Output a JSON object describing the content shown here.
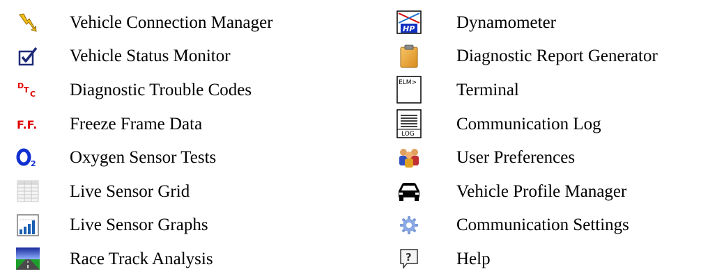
{
  "left_menu": {
    "items": [
      {
        "label": "Vehicle Connection Manager",
        "icon": "lightning-bolt-icon"
      },
      {
        "label": "Vehicle Status Monitor",
        "icon": "checkbox-checked-icon"
      },
      {
        "label": "Diagnostic Trouble Codes",
        "icon": "dtc-icon"
      },
      {
        "label": "Freeze Frame Data",
        "icon": "freeze-frame-icon"
      },
      {
        "label": "Oxygen Sensor Tests",
        "icon": "oxygen-sensor-icon"
      },
      {
        "label": "Live Sensor Grid",
        "icon": "grid-table-icon"
      },
      {
        "label": "Live Sensor Graphs",
        "icon": "bar-graph-icon"
      },
      {
        "label": "Race Track Analysis",
        "icon": "race-track-icon"
      }
    ]
  },
  "right_menu": {
    "items": [
      {
        "label": "Dynamometer",
        "icon": "dynamometer-hp-icon",
        "icon_text": "HP"
      },
      {
        "label": "Diagnostic Report Generator",
        "icon": "clipboard-icon"
      },
      {
        "label": "Terminal",
        "icon": "terminal-elm-icon",
        "icon_text": "ELM>"
      },
      {
        "label": "Communication Log",
        "icon": "log-document-icon",
        "icon_text": "LOG"
      },
      {
        "label": "User Preferences",
        "icon": "users-icon"
      },
      {
        "label": "Vehicle Profile Manager",
        "icon": "car-icon"
      },
      {
        "label": "Communication Settings",
        "icon": "gear-icon"
      },
      {
        "label": "Help",
        "icon": "help-icon",
        "icon_text": "?"
      }
    ]
  }
}
